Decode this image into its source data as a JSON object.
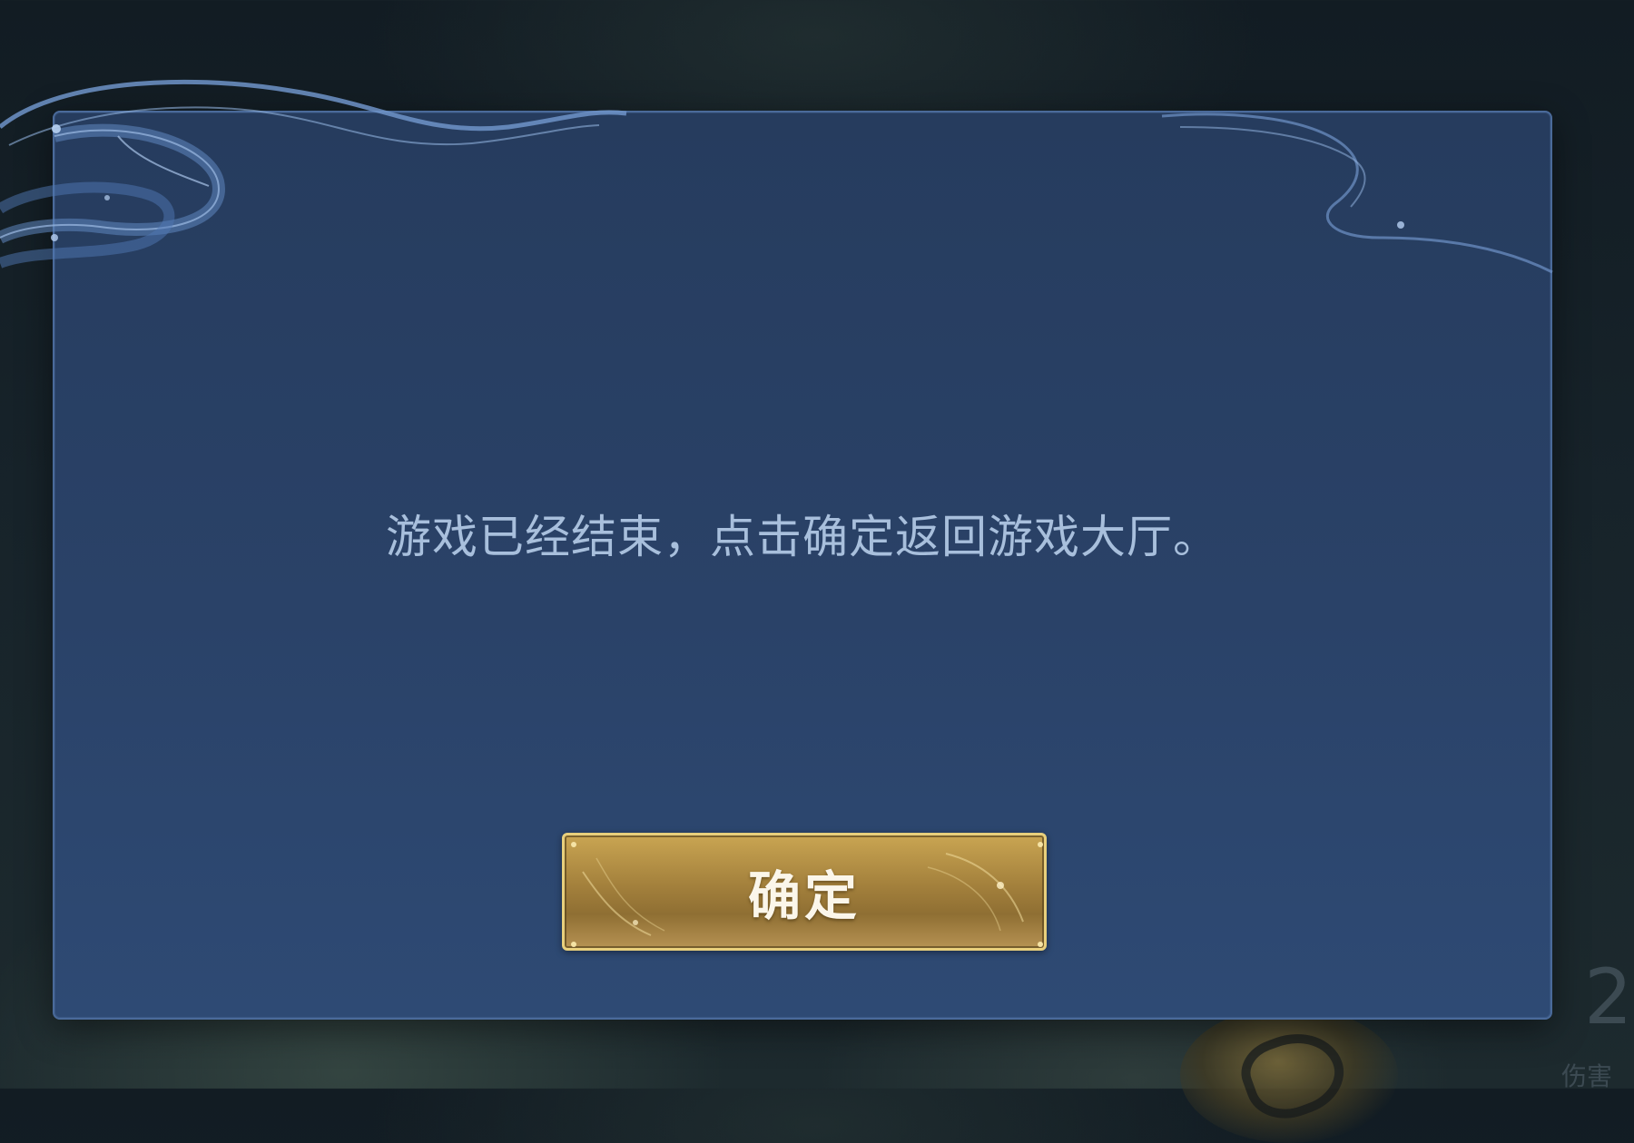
{
  "dialog": {
    "message": "游戏已经结束，点击确定返回游戏大厅。",
    "confirm_label": "确定"
  },
  "background": {
    "number": "2",
    "caption": "伤害"
  },
  "icons": {
    "swirl": "cloud-swirl-ornament"
  },
  "colors": {
    "panel": "#2a4268",
    "panel_border": "#4a6a9a",
    "message_text": "#a8bfdc",
    "button_gold": "#b69253",
    "button_border": "#e8cf7c",
    "button_text": "#fbf6ea"
  }
}
